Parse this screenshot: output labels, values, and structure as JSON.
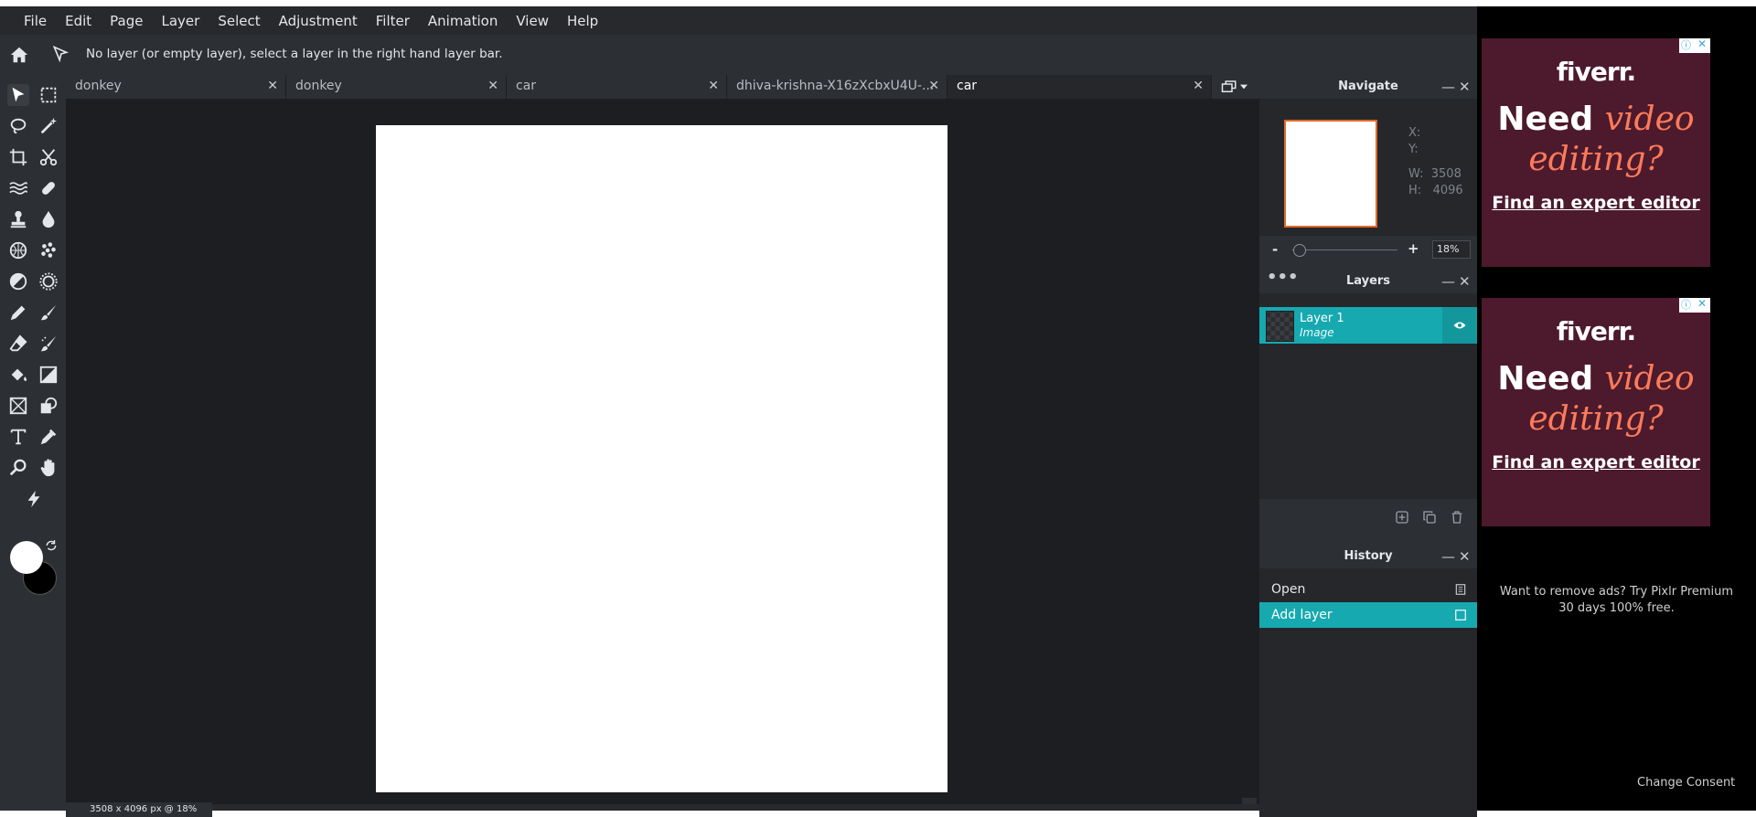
{
  "menu": [
    "File",
    "Edit",
    "Page",
    "Layer",
    "Select",
    "Adjustment",
    "Filter",
    "Animation",
    "View",
    "Help"
  ],
  "options_bar": {
    "message": "No layer (or empty layer), select a layer in the right hand layer bar."
  },
  "tabs": [
    {
      "label": "donkey",
      "active": false
    },
    {
      "label": "donkey",
      "active": false
    },
    {
      "label": "car",
      "active": false
    },
    {
      "label": "dhiva-krishna-X16zXcbxU4U-...",
      "active": false
    },
    {
      "label": "car",
      "active": true
    }
  ],
  "status_bar": "3508 x 4096 px @ 18%",
  "navigate": {
    "title": "Navigate",
    "x_label": "X:",
    "y_label": "Y:",
    "w_label": "W:",
    "w_value": "3508",
    "h_label": "H:",
    "h_value": "4096",
    "zoom": "18%",
    "minus": "-",
    "plus": "+"
  },
  "layers": {
    "title": "Layers",
    "items": [
      {
        "name": "Layer 1",
        "type": "Image"
      }
    ]
  },
  "history": {
    "title": "History",
    "items": [
      {
        "label": "Open",
        "active": false
      },
      {
        "label": "Add layer",
        "active": true
      }
    ]
  },
  "ads": [
    {
      "brand": "fiverr.",
      "need": "Need",
      "video": "video",
      "editing": "editing?",
      "cta": "Find an expert editor"
    },
    {
      "brand": "fiverr.",
      "need": "Need",
      "video": "video",
      "editing": "editing?",
      "cta": "Find an expert editor"
    }
  ],
  "promo": "Want to remove ads? Try Pixlr Premium 30 days 100% free.",
  "consent": "Change Consent",
  "colors": {
    "accent": "#16a9b0",
    "ad_bg": "#4c1a2c",
    "ad_accent": "#ff7a5a"
  }
}
